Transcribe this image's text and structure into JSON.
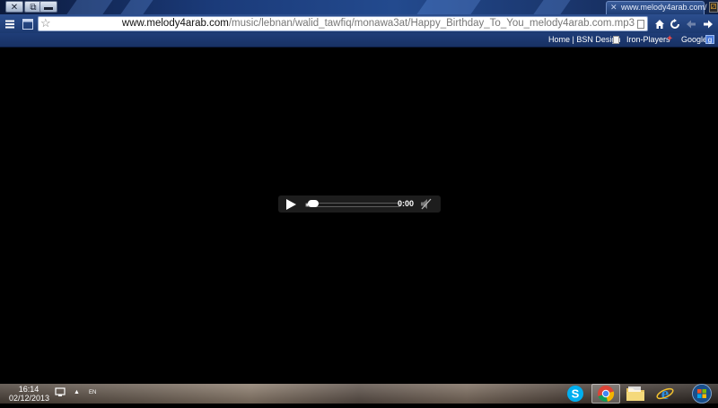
{
  "window": {
    "close_glyph": "✕",
    "restore_glyph": "⧉",
    "minimize_glyph": "▬"
  },
  "tab": {
    "title": "www.melody4arab.com/",
    "close_glyph": "✕"
  },
  "nav": {
    "url_host": "www.melody4arab.com",
    "url_path": "/music/lebnan/walid_tawfiq/monawa3at/Happy_Birthday_To_You_melody4arab.com.mp3",
    "icons": [
      "menu-icon",
      "tabs-icon",
      "star-icon",
      "home-icon",
      "reload-icon",
      "back-icon",
      "forward-icon"
    ]
  },
  "bookmarks": {
    "home_bsn": "Home | BSN Design",
    "iron_players": "Iron-Players",
    "google": "Google"
  },
  "player": {
    "time": "0:00",
    "progress": 0.03
  },
  "taskbar": {
    "time": "16:14",
    "date": "02/12/2013",
    "language": "EN",
    "apps": [
      "skype-icon",
      "chrome-icon",
      "folder-icon",
      "internet-explorer-icon",
      "start-orb-icon"
    ],
    "active_app": "chrome-icon"
  },
  "colors": {
    "chrome_blue": "#1c3a70",
    "background": "#000000",
    "player_bg": "#1d1d1d"
  }
}
